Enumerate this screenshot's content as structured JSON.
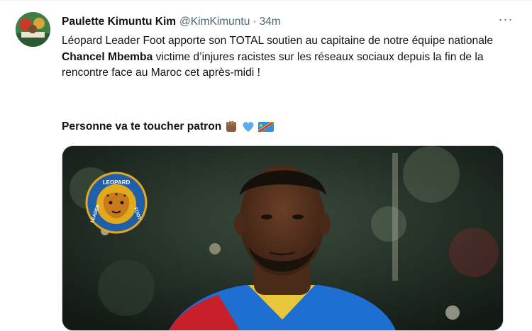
{
  "tweet": {
    "author_name": "Paulette Kimuntu Kim",
    "handle": "@KimKimuntu",
    "separator": "·",
    "time": "34m",
    "more_label": "···",
    "text_part1": "Léopard Leader Foot apporte son TOTAL soutien au capitaine de notre équipe nationale ",
    "text_bold": "Chancel Mbemba",
    "text_part2": " victime d’injures racistes sur les réseaux sociaux depuis la fin de la rencontre face au Maroc cet après-midi !",
    "line2": "Personne va te toucher patron",
    "emojis": [
      "raised-fist-icon",
      "blue-heart-icon",
      "flag-drc-icon"
    ]
  },
  "logo": {
    "top_text": "LEOPARD",
    "left_text": "LEADER",
    "right_text": "FOOT"
  },
  "colors": {
    "secondary_text": "#536471",
    "border": "#cfd9de",
    "logo_ring": "#1f5ea8",
    "logo_inner": "#e3a91c",
    "jersey_blue": "#1e6fd1",
    "jersey_red": "#c8202a"
  }
}
